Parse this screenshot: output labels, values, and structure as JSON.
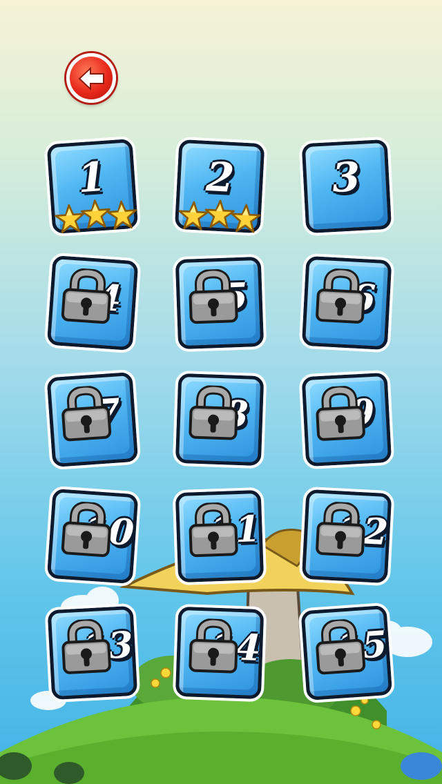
{
  "navigation": {
    "back_icon": "arrow-left-icon",
    "back_color": "#e8291b"
  },
  "levels": [
    {
      "label": "1",
      "locked": false,
      "stars": 3
    },
    {
      "label": "2",
      "locked": false,
      "stars": 3
    },
    {
      "label": "3",
      "locked": false,
      "stars": 0
    },
    {
      "label": "4",
      "locked": true,
      "stars": 0
    },
    {
      "label": "5",
      "locked": true,
      "stars": 0
    },
    {
      "label": "6",
      "locked": true,
      "stars": 0
    },
    {
      "label": "7",
      "locked": true,
      "stars": 0
    },
    {
      "label": "8",
      "locked": true,
      "stars": 0
    },
    {
      "label": "9",
      "locked": true,
      "stars": 0
    },
    {
      "label": "10",
      "locked": true,
      "stars": 0
    },
    {
      "label": "11",
      "locked": true,
      "stars": 0
    },
    {
      "label": "12",
      "locked": true,
      "stars": 0
    },
    {
      "label": "13",
      "locked": true,
      "stars": 0
    },
    {
      "label": "14",
      "locked": true,
      "stars": 0
    },
    {
      "label": "15",
      "locked": true,
      "stars": 0
    }
  ],
  "theme": {
    "tile_color": "#4fb6f2",
    "star_color": "#ffd23a",
    "lock_icon": "padlock-icon",
    "star_icon": "star-icon"
  }
}
